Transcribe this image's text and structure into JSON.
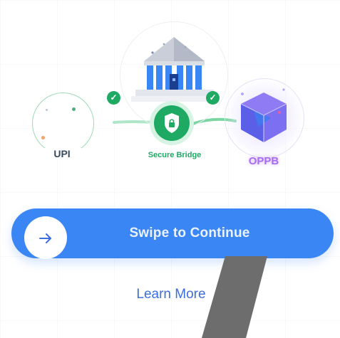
{
  "nodes": {
    "upi": {
      "label": "UPI"
    },
    "bridge": {
      "label": "Secure Bridge"
    },
    "oppb": {
      "label": "OPPB"
    }
  },
  "action": {
    "swipe_label": "Swipe to Continue",
    "learn_more": "Learn More"
  },
  "icons": {
    "arrow": "arrow-right-icon",
    "shield": "shield-lock-icon",
    "bank": "bank-building-icon",
    "check": "check-icon",
    "cube": "cube-icon"
  },
  "colors": {
    "primary": "#3b86f5",
    "success": "#1faa64",
    "accent_purple": "#a86cf0",
    "link": "#3b6fe0"
  }
}
